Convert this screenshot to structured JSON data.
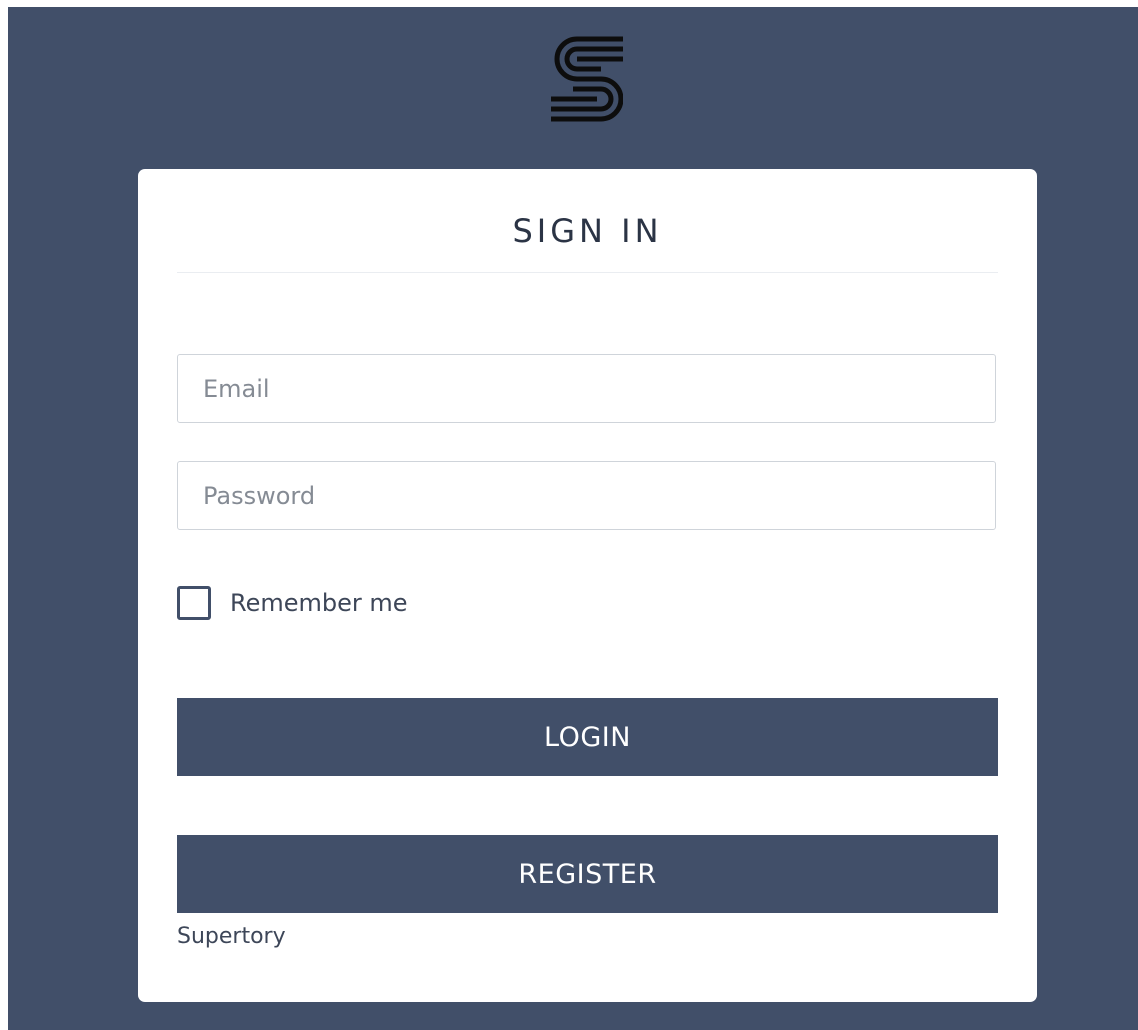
{
  "logo": {
    "icon": "brand-s-logo",
    "color": "#0d0d0d"
  },
  "card": {
    "title": "SIGN IN",
    "email": {
      "placeholder": "Email",
      "value": ""
    },
    "password": {
      "placeholder": "Password",
      "value": ""
    },
    "remember_me": {
      "label": "Remember me",
      "checked": false
    },
    "login_label": "LOGIN",
    "register_label": "REGISTER",
    "footer_text": "Supertory"
  },
  "colors": {
    "background": "#414f69",
    "card": "#ffffff",
    "button": "#414f69",
    "button_text": "#ffffff",
    "title_text": "#2b3445"
  }
}
